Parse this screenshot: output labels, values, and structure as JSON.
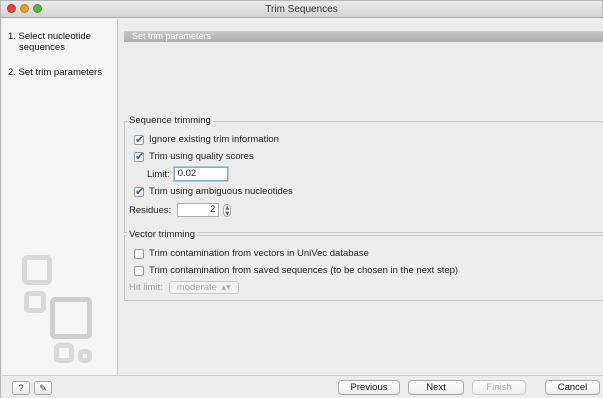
{
  "window": {
    "title": "Trim Sequences"
  },
  "sidebar": {
    "steps": [
      {
        "label_line1": "1. Select nucleotide",
        "label_line2": "sequences"
      },
      {
        "label_line1": "2. Set trim parameters"
      }
    ]
  },
  "main": {
    "section_header": "Set trim parameters",
    "sequence_trimming": {
      "title": "Sequence trimming",
      "ignore_existing": {
        "label": "Ignore existing trim information",
        "checked": true
      },
      "quality_scores": {
        "label": "Trim using quality scores",
        "checked": true
      },
      "limit": {
        "label": "Limit:",
        "value": "0.02"
      },
      "ambiguous": {
        "label": "Trim using ambiguous nucleotides",
        "checked": true
      },
      "residues": {
        "label": "Residues:",
        "value": "2"
      }
    },
    "vector_trimming": {
      "title": "Vector trimming",
      "univec": {
        "label": "Trim contamination from vectors in UniVec database",
        "checked": false
      },
      "saved": {
        "label": "Trim contamination from saved sequences (to be chosen in the next step)",
        "checked": false
      },
      "hit_limit": {
        "label": "Hit limit:",
        "value": "moderate"
      }
    }
  },
  "footer": {
    "help_label": "?",
    "previous_label": "Previous",
    "next_label": "Next",
    "finish_label": "Finish",
    "cancel_label": "Cancel"
  }
}
